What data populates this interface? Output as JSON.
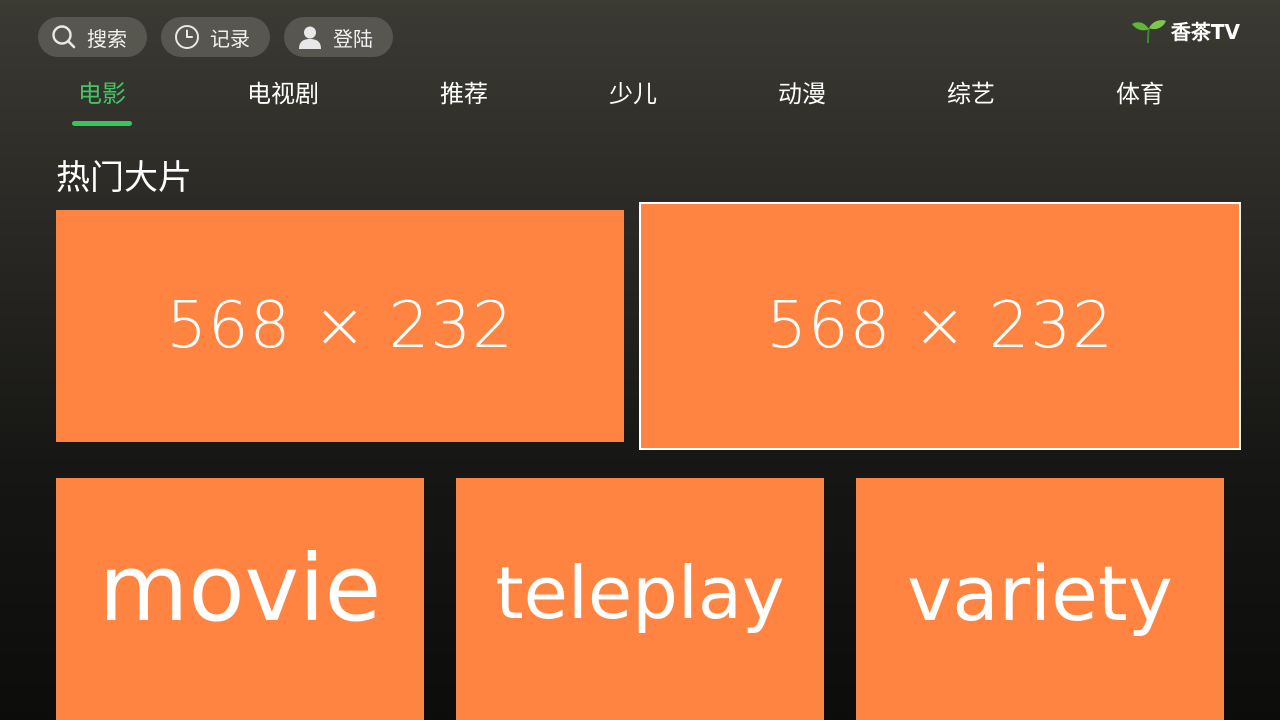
{
  "header": {
    "buttons": [
      {
        "label": "搜索",
        "icon": "search-icon"
      },
      {
        "label": "记录",
        "icon": "clock-icon"
      },
      {
        "label": "登陆",
        "icon": "user-icon"
      }
    ],
    "brand": {
      "name": "香茶TV",
      "icon": "leaf-icon"
    }
  },
  "nav": {
    "tabs": [
      {
        "label": "电影",
        "active": true
      },
      {
        "label": "电视剧",
        "active": false
      },
      {
        "label": "推荐",
        "active": false
      },
      {
        "label": "少儿",
        "active": false
      },
      {
        "label": "动漫",
        "active": false
      },
      {
        "label": "综艺",
        "active": false
      },
      {
        "label": "体育",
        "active": false
      }
    ],
    "active_color": "#43c463"
  },
  "section": {
    "title": "热门大片",
    "banners": [
      {
        "label": "568 × 232",
        "focused": false
      },
      {
        "label": "568 × 232",
        "focused": true
      }
    ]
  },
  "categories": [
    {
      "label": "movie"
    },
    {
      "label": "teleplay"
    },
    {
      "label": "variety"
    }
  ],
  "colors": {
    "tile": "#ff8442",
    "pill": "#58574f",
    "focus_border": "#ffffff"
  }
}
